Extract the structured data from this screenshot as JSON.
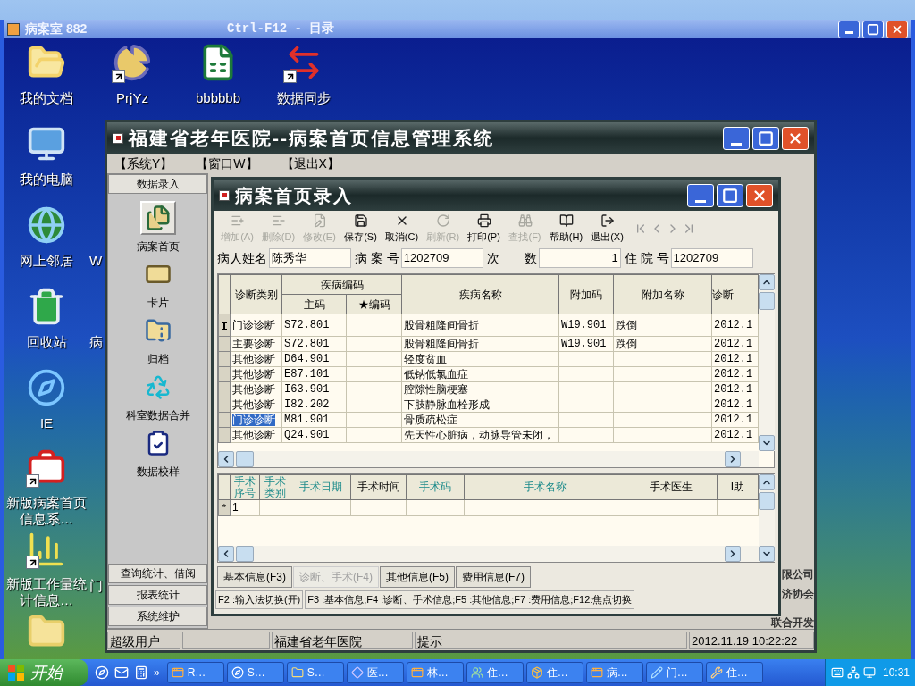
{
  "outer_window": {
    "title": "病案室 882",
    "center_title": "Ctrl-F12 - 目录"
  },
  "desktop": {
    "top_row": [
      {
        "label": "我的文档",
        "kind": "documents",
        "shortcut": false
      },
      {
        "label": "PrjYz",
        "kind": "pie",
        "shortcut": true
      },
      {
        "label": "bbbbbb",
        "kind": "spreadsheet",
        "shortcut": false
      },
      {
        "label": "数据同步",
        "kind": "sync",
        "shortcut": true
      }
    ],
    "left_column": [
      {
        "label": "我的电脑",
        "kind": "computer",
        "shortcut": false
      },
      {
        "label": "网上邻居",
        "kind": "network",
        "shortcut": false,
        "next_label": "W"
      },
      {
        "label": "回收站",
        "kind": "recycle",
        "shortcut": false,
        "next_label": "病"
      },
      {
        "label": "IE",
        "kind": "browser",
        "shortcut": false
      },
      {
        "label": "新版病案首页信息系…",
        "kind": "medkit",
        "shortcut": true
      },
      {
        "label": "新版工作量统计信息…",
        "kind": "chart",
        "shortcut": true,
        "next_label": "门"
      },
      {
        "kind": "folder",
        "shortcut": false
      }
    ]
  },
  "app_window": {
    "title": "福建省老年医院--病案首页信息管理系统",
    "menu": [
      "【系统Y】",
      "【窗口W】",
      "【退出X】"
    ],
    "nav_header": "数据录入",
    "nav_items": [
      {
        "label": "病案首页",
        "kind": "records",
        "selected": true
      },
      {
        "label": "卡片",
        "kind": "card",
        "selected": false
      },
      {
        "label": "归档",
        "kind": "archive",
        "selected": false
      },
      {
        "label": "科室数据合并",
        "kind": "merge",
        "selected": false
      },
      {
        "label": "数据校样",
        "kind": "verify",
        "selected": false
      }
    ],
    "nav_sections": [
      "查询统计、借阅",
      "报表统计",
      "系统维护"
    ],
    "background_texts": [
      "限公司",
      "济协会",
      "联合开发"
    ],
    "status_bar": {
      "user": "超级用户",
      "hospital": "福建省老年医院",
      "hint": "提示",
      "datetime": "2012.11.19 10:22:22"
    }
  },
  "entry_window": {
    "title": "病案首页录入",
    "toolbar": [
      {
        "label": "增加(A)",
        "kind": "add",
        "disabled": true
      },
      {
        "label": "删除(D)",
        "kind": "delete",
        "disabled": true
      },
      {
        "label": "修改(E)",
        "kind": "edit",
        "disabled": true
      },
      {
        "label": "保存(S)",
        "kind": "save",
        "disabled": false
      },
      {
        "label": "取消(C)",
        "kind": "cancel",
        "disabled": false
      },
      {
        "label": "刷新(R)",
        "kind": "refresh",
        "disabled": true
      },
      {
        "label": "打印(P)",
        "kind": "print",
        "disabled": false
      },
      {
        "label": "查找(F)",
        "kind": "find",
        "disabled": true
      },
      {
        "label": "帮助(H)",
        "kind": "help",
        "disabled": false
      },
      {
        "label": "退出(X)",
        "kind": "exit",
        "disabled": false
      }
    ],
    "patient": [
      {
        "label": "病人姓名",
        "value": "陈秀华",
        "kind": "text"
      },
      {
        "label": "病 案 号",
        "value": "1202709",
        "kind": "text"
      },
      {
        "label": "次　　数",
        "value": "1",
        "kind": "number"
      },
      {
        "label": "住 院 号",
        "value": "1202709",
        "kind": "text"
      }
    ],
    "diagnosis_table": {
      "columns": {
        "type": "诊断类别",
        "code_group": "疾病编码",
        "main_code": "主码",
        "star_code": "★编码",
        "name": "疾病名称",
        "extra_code": "附加码",
        "extra_name": "附加名称",
        "column_8": "诊断"
      },
      "rows": [
        {
          "type": "门诊诊断",
          "main_code": "S72.801",
          "name": "股骨粗隆间骨折",
          "extra_code": "W19.901",
          "extra_name": "跌倒",
          "column_8": "2012.1",
          "current": true,
          "highlighted": false
        },
        {
          "type": "主要诊断",
          "main_code": "S72.801",
          "name": "股骨粗隆间骨折",
          "extra_code": "W19.901",
          "extra_name": "跌倒",
          "column_8": "2012.1",
          "current": false,
          "highlighted": false
        },
        {
          "type": "其他诊断",
          "main_code": "D64.901",
          "name": "轻度贫血",
          "column_8": "2012.1",
          "current": false,
          "highlighted": false
        },
        {
          "type": "其他诊断",
          "main_code": "E87.101",
          "name": "低钠低氯血症",
          "column_8": "2012.1",
          "current": false,
          "highlighted": false
        },
        {
          "type": "其他诊断",
          "main_code": "I63.901",
          "name": "腔隙性脑梗塞",
          "column_8": "2012.1",
          "current": false,
          "highlighted": false
        },
        {
          "type": "其他诊断",
          "main_code": "I82.202",
          "name": "下肢静脉血栓形成",
          "column_8": "2012.1",
          "current": false,
          "highlighted": false
        },
        {
          "type": "门诊诊断",
          "main_code": "M81.901",
          "name": "骨质疏松症",
          "column_8": "2012.1",
          "current": false,
          "highlighted": true
        },
        {
          "type": "其他诊断",
          "main_code": "Q24.901",
          "name": "先天性心脏病，动脉导管未闭，",
          "column_8": "2012.1",
          "current": false,
          "highlighted": false
        }
      ]
    },
    "surgery_table": {
      "columns": [
        {
          "label": "手术序号",
          "required": true
        },
        {
          "label": "手术类别",
          "required": true
        },
        {
          "label": "手术日期",
          "required": true
        },
        {
          "label": "手术时间",
          "required": false
        },
        {
          "label": "手术码",
          "required": true
        },
        {
          "label": "手术名称",
          "required": true
        },
        {
          "label": "手术医生",
          "required": false
        },
        {
          "label": "I助",
          "required": false
        }
      ],
      "rows": [
        {
          "marker": "*",
          "seq": "1"
        }
      ]
    },
    "tabs": [
      {
        "label": "基本信息(F3)",
        "selected": false
      },
      {
        "label": "诊断、手术(F4)",
        "selected": true
      },
      {
        "label": "其他信息(F5)",
        "selected": false
      },
      {
        "label": "费用信息(F7)",
        "selected": false
      }
    ],
    "hints": [
      "F2 :输入法切换(开)",
      "F3 :基本信息;F4 :诊断、手术信息;F5 :其他信息;F7 :费用信息;F12:焦点切换"
    ]
  },
  "taskbar": {
    "start": "开始",
    "quick_launch": [
      {
        "kind": "browser"
      },
      {
        "kind": "mail"
      },
      {
        "kind": "calculator"
      }
    ],
    "overflow": "»",
    "tasks": [
      {
        "label": "R…",
        "kind": "app"
      },
      {
        "label": "S…",
        "kind": "compass"
      },
      {
        "label": "S…",
        "kind": "folder"
      },
      {
        "label": "医…",
        "kind": "diamond"
      },
      {
        "label": "林…",
        "kind": "app"
      },
      {
        "label": "住…",
        "kind": "people"
      },
      {
        "label": "住…",
        "kind": "box"
      },
      {
        "label": "病…",
        "kind": "app"
      },
      {
        "label": "门…",
        "kind": "pencil"
      },
      {
        "label": "住…",
        "kind": "tool"
      }
    ],
    "clock": "10:31"
  }
}
